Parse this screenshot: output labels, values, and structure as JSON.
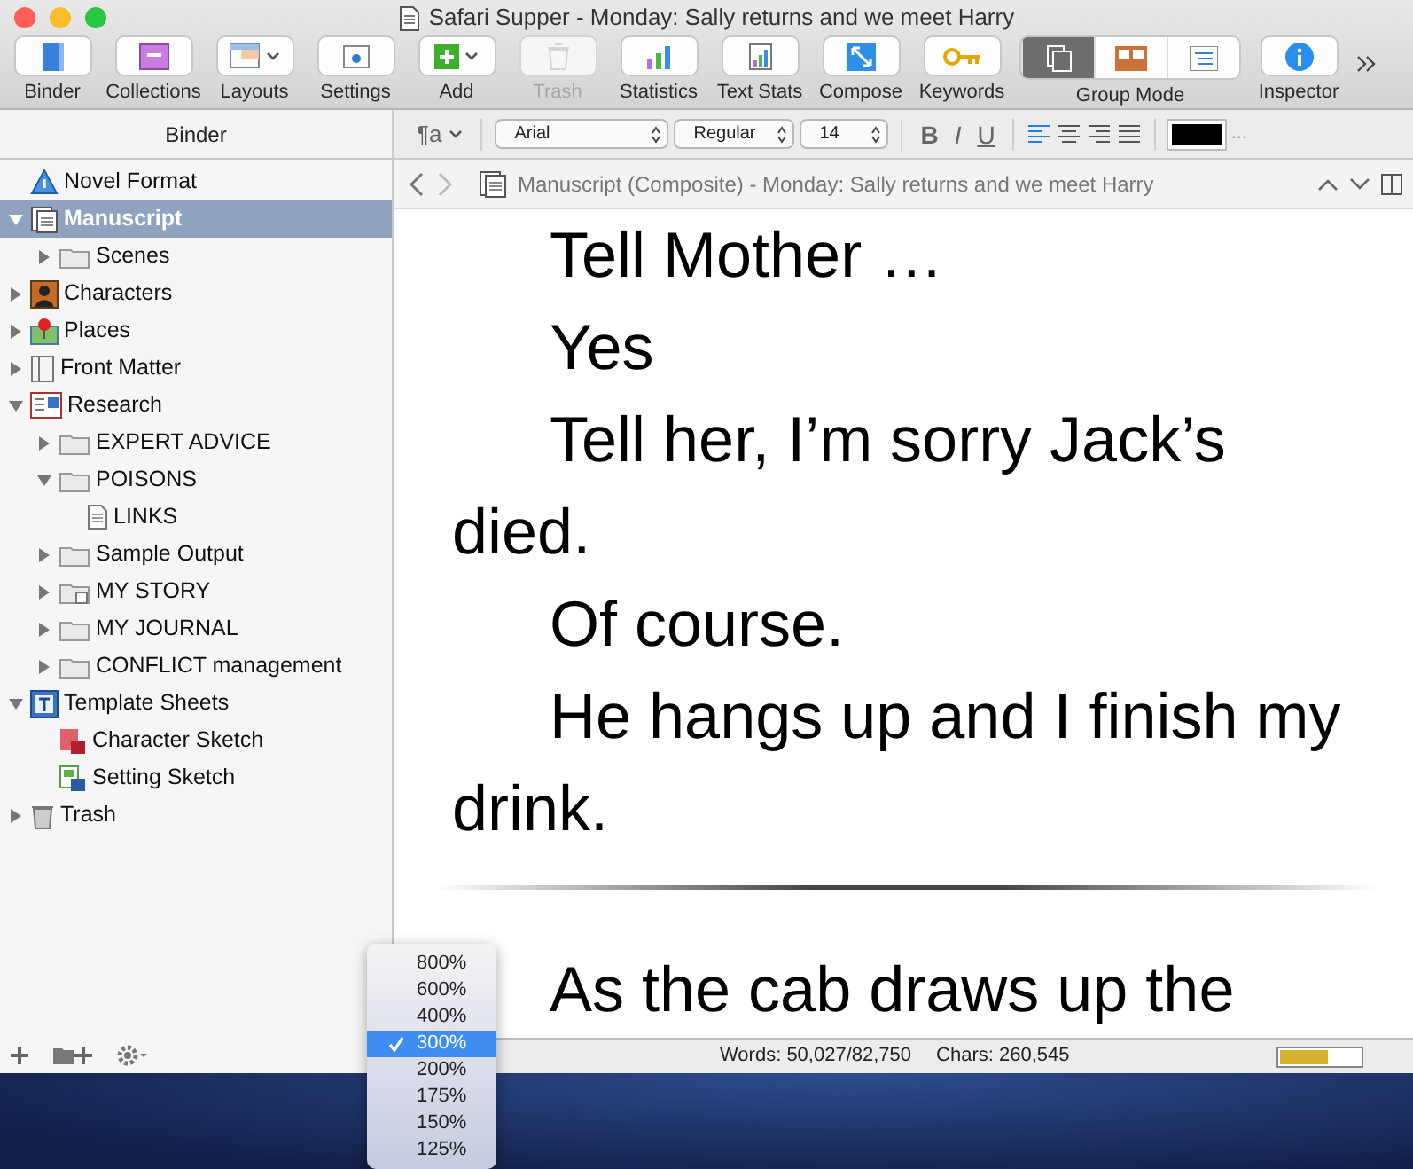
{
  "window": {
    "title": "Safari Supper - Monday: Sally returns and we meet Harry"
  },
  "toolbar": [
    {
      "kind": "button",
      "label": "Binder",
      "disabled": false
    },
    {
      "kind": "button",
      "label": "Collections",
      "disabled": false
    },
    {
      "kind": "button",
      "label": "Layouts",
      "disabled": false
    },
    {
      "kind": "button",
      "label": "Settings",
      "disabled": false
    },
    {
      "kind": "button",
      "label": "Add",
      "disabled": false
    },
    {
      "kind": "button",
      "label": "Trash",
      "disabled": true
    },
    {
      "kind": "button",
      "label": "Statistics",
      "disabled": false
    },
    {
      "kind": "button",
      "label": "Text Stats",
      "disabled": false
    },
    {
      "kind": "button",
      "label": "Compose",
      "disabled": false
    },
    {
      "kind": "button",
      "label": "Keywords",
      "disabled": false
    },
    {
      "kind": "segmented",
      "label": "Group Mode",
      "segments": [
        {
          "selected": true
        },
        {
          "selected": false
        },
        {
          "selected": false
        }
      ]
    },
    {
      "kind": "button",
      "label": "Inspector",
      "disabled": false
    }
  ],
  "binder": {
    "header": "Binder",
    "items": [
      {
        "label": "Novel Format",
        "kind": "info",
        "selected": false
      },
      {
        "label": "Manuscript",
        "kind": "manuscript",
        "selected": true,
        "expanded": true,
        "children": [
          {
            "label": "Scenes",
            "kind": "folder",
            "selected": false,
            "expanded": false
          }
        ]
      },
      {
        "label": "Characters",
        "kind": "characters",
        "selected": false,
        "expanded": false
      },
      {
        "label": "Places",
        "kind": "places",
        "selected": false,
        "expanded": false
      },
      {
        "label": "Front Matter",
        "kind": "frontmatter",
        "selected": false,
        "expanded": false
      },
      {
        "label": "Research",
        "kind": "research",
        "selected": false,
        "expanded": true,
        "children": [
          {
            "label": "EXPERT ADVICE",
            "kind": "folder",
            "selected": false,
            "expanded": false
          },
          {
            "label": "POISONS",
            "kind": "folder",
            "selected": false,
            "expanded": true,
            "children": [
              {
                "label": "LINKS",
                "kind": "document",
                "selected": false
              }
            ]
          },
          {
            "label": "Sample Output",
            "kind": "folder",
            "selected": false,
            "expanded": false
          },
          {
            "label": "MY STORY",
            "kind": "storyfolder",
            "selected": false,
            "expanded": false
          },
          {
            "label": "MY JOURNAL",
            "kind": "folder",
            "selected": false,
            "expanded": false
          },
          {
            "label": "CONFLICT management",
            "kind": "folder",
            "selected": false,
            "expanded": false
          }
        ]
      },
      {
        "label": "Template Sheets",
        "kind": "template",
        "selected": false,
        "expanded": true,
        "children": [
          {
            "label": "Character Sketch",
            "kind": "charsheet",
            "selected": false
          },
          {
            "label": "Setting Sketch",
            "kind": "settingsheet",
            "selected": false
          }
        ]
      },
      {
        "label": "Trash",
        "kind": "trashcan",
        "selected": false,
        "expanded": false
      }
    ]
  },
  "format_bar": {
    "style_menu": "¶a",
    "font": "Arial",
    "typeface": "Regular",
    "size": "14",
    "styles": [
      {
        "kind": "bold",
        "label": "B"
      },
      {
        "kind": "italic",
        "label": "I"
      },
      {
        "kind": "underline",
        "label": "U"
      }
    ],
    "alignments": [
      {
        "kind": "left",
        "selected": true
      },
      {
        "kind": "center",
        "selected": false
      },
      {
        "kind": "right",
        "selected": false
      },
      {
        "kind": "justify",
        "selected": false
      }
    ],
    "more": "..."
  },
  "editor": {
    "header_title": "Manuscript (Composite) - Monday: Sally returns and we meet Harry",
    "sections": [
      {
        "paragraphs": [
          "Tell Mother …",
          "Yes",
          "Tell her, I’m sorry Jack’s died.",
          "Of course.",
          "He hangs up and I finish my drink."
        ]
      },
      {
        "paragraphs": [
          "As the cab draws up the"
        ]
      }
    ]
  },
  "status_bar": {
    "words": "Words: 50,027/82,750",
    "chars": "Chars: 260,545",
    "target": {
      "level": 0.6
    }
  },
  "zoom_menu": {
    "items": [
      {
        "label": "800%",
        "selected": false
      },
      {
        "label": "600%",
        "selected": false
      },
      {
        "label": "400%",
        "selected": false
      },
      {
        "label": "300%",
        "selected": true
      },
      {
        "label": "200%",
        "selected": false
      },
      {
        "label": "175%",
        "selected": false
      },
      {
        "label": "150%",
        "selected": false
      },
      {
        "label": "125%",
        "selected": false
      }
    ]
  }
}
